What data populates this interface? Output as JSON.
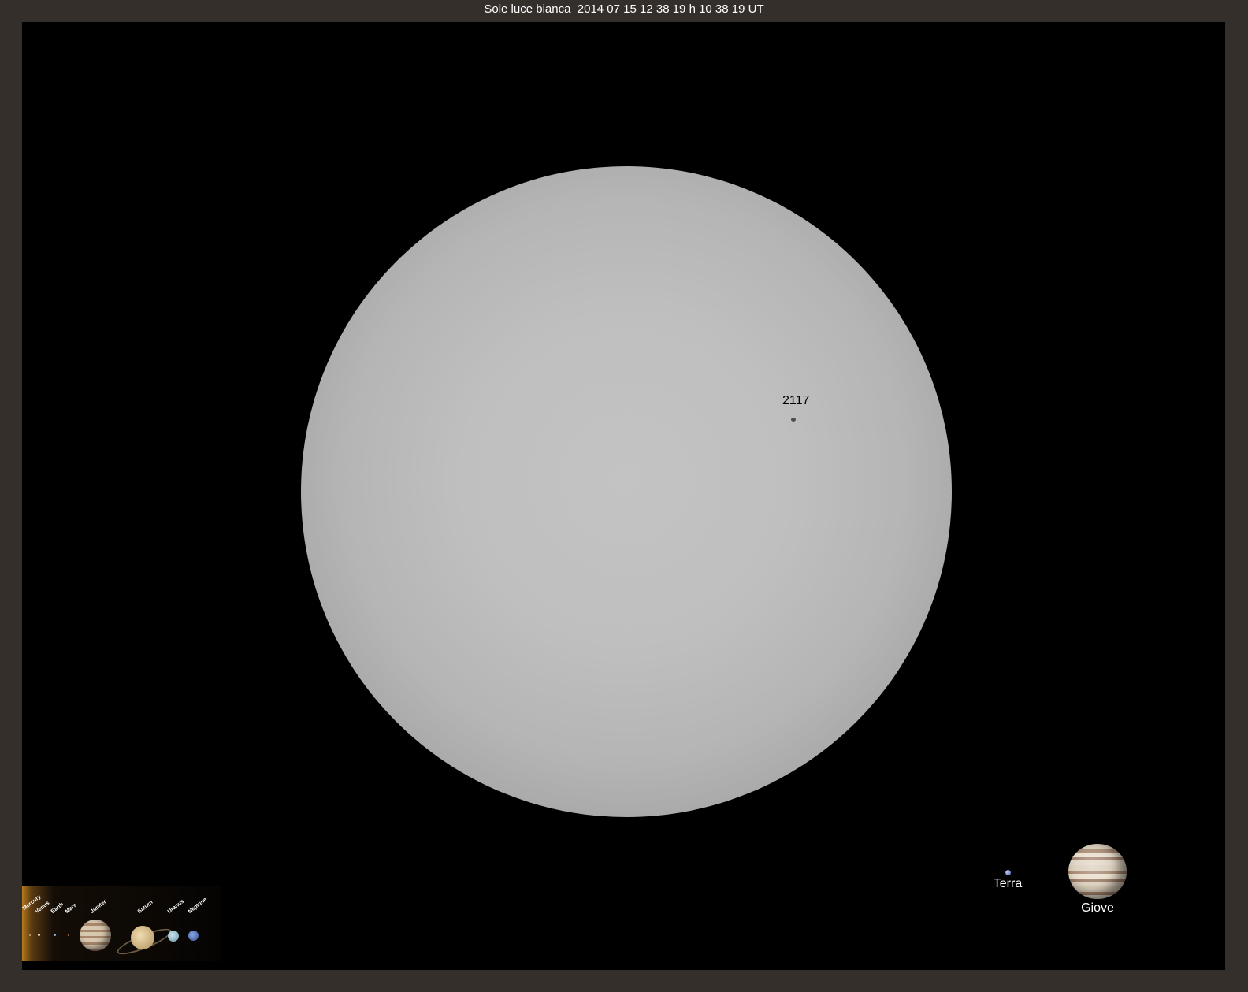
{
  "title": "Sole luce bianca  2014 07 15 12 38 19 h 10 38 19 UT",
  "sun": {
    "region_label": "2117"
  },
  "comparison": {
    "earth_label": "Terra",
    "jupiter_label": "Giove"
  },
  "inset": {
    "labels": [
      "Mercury",
      "Venus",
      "Earth",
      "Mars",
      "Jupiter",
      "Saturn",
      "Uranus",
      "Neptune"
    ]
  },
  "colors": {
    "frame_border": "#352f2c",
    "background": "#000000",
    "title_text": "#ffffff"
  }
}
